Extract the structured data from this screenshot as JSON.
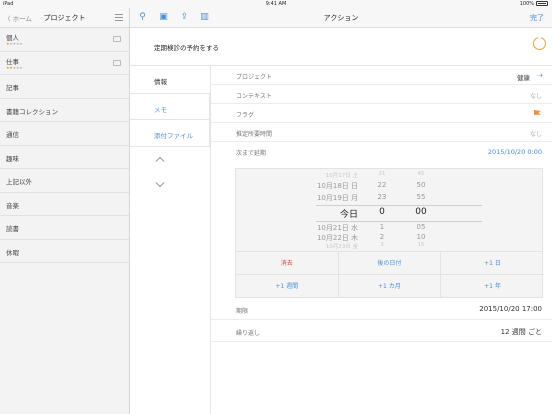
{
  "status": {
    "carrier": "iPad",
    "time": "9:41 AM",
    "battery": "100%"
  },
  "sidebar": {
    "back_label": "〈 ホーム",
    "title": "プロジェクト",
    "items": [
      {
        "label": "個人",
        "stars": "★☆☆☆☆",
        "stars_filled": 1,
        "folder": true
      },
      {
        "label": "仕事",
        "stars": "★★☆☆☆",
        "stars_filled": 2,
        "folder": true
      },
      {
        "label": "記事"
      },
      {
        "label": "書籍コレクション"
      },
      {
        "label": "通信"
      },
      {
        "label": "趣味"
      },
      {
        "label": "上記以外"
      },
      {
        "label": "音楽"
      },
      {
        "label": "読書"
      },
      {
        "label": "休暇"
      }
    ]
  },
  "toolbar": {
    "title": "アクション",
    "done": "完了"
  },
  "task": {
    "title": "定期検診の予約をする"
  },
  "tabs": {
    "info": "情報",
    "memo": "メモ",
    "attachments": "添付ファイル"
  },
  "fields": {
    "project_label": "プロジェクト",
    "project_value": "健康",
    "context_label": "コンテキスト",
    "context_value": "なし",
    "flag_label": "フラグ",
    "estimate_label": "推定所要時間",
    "estimate_value": "なし",
    "defer_label": "次まで延期",
    "defer_value": "2015/10/20 0:00",
    "due_label": "期限",
    "due_value": "2015/10/20  17:00",
    "repeat_label": "繰り返し",
    "repeat_value": "12 週間 ごと"
  },
  "picker": {
    "rows": [
      [
        "10月17日 土",
        "21",
        "45"
      ],
      [
        "10月18日 日",
        "22",
        "50"
      ],
      [
        "10月19日 月",
        "23",
        "55"
      ],
      [
        "今日",
        "0",
        "00"
      ],
      [
        "10月21日 水",
        "1",
        "05"
      ],
      [
        "10月22日 木",
        "2",
        "10"
      ],
      [
        "10月23日 金",
        "3",
        "15"
      ]
    ],
    "buttons": [
      "消去",
      "後の日付",
      "+1 日",
      "+1 週間",
      "+1 カ月",
      "+1 年"
    ]
  },
  "colors": {
    "accent": "#4a8fd9",
    "destructive": "#e0473a",
    "star": "#e2a23a",
    "flag": "#f0903a"
  }
}
